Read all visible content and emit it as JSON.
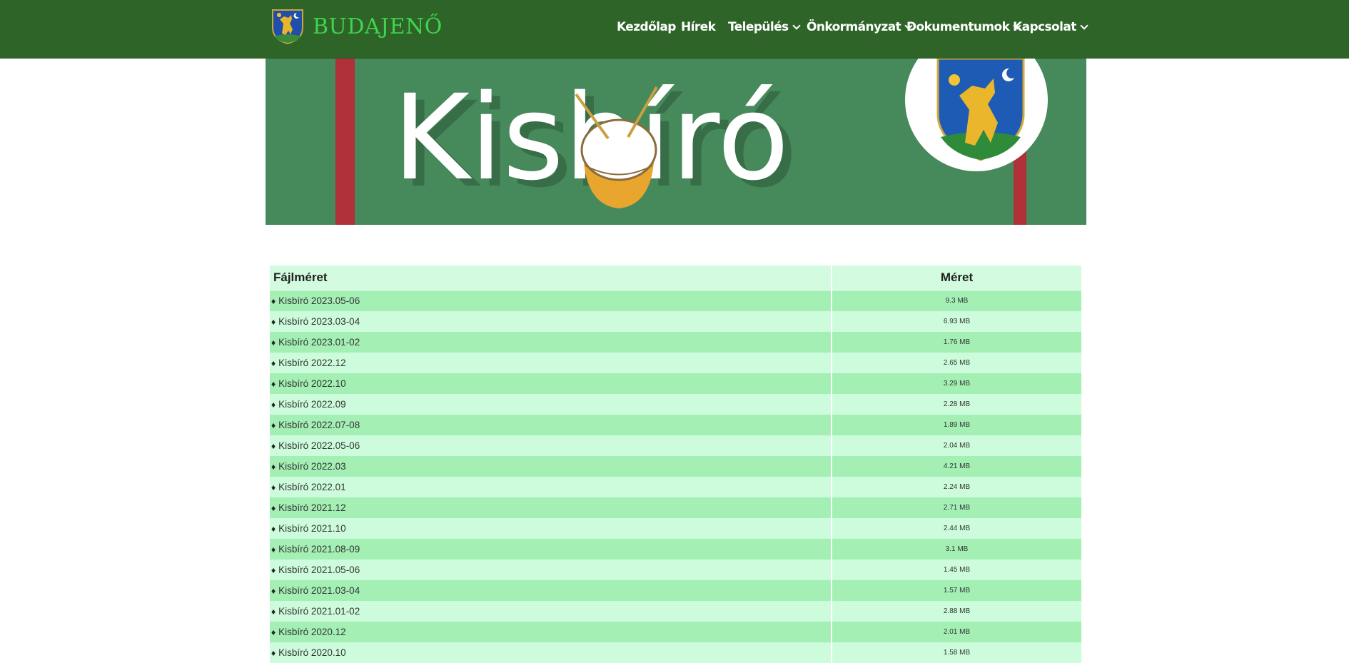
{
  "site": {
    "name": "BUDAJENŐ",
    "logo_icon": "coat-of-arms-icon"
  },
  "nav": {
    "items": [
      {
        "label": "Kezdőlap",
        "dropdown": false
      },
      {
        "label": "Hírek",
        "dropdown": false
      },
      {
        "label": "Település",
        "dropdown": true
      },
      {
        "label": "Önkormányzat",
        "dropdown": true
      },
      {
        "label": "Dokumentumok",
        "dropdown": true
      },
      {
        "label": "Kapcsolat",
        "dropdown": true
      }
    ]
  },
  "banner": {
    "title": "Kisbíró",
    "icons": [
      "drum-icon",
      "coat-of-arms-icon"
    ]
  },
  "table": {
    "headers": {
      "name": "Fájlméret",
      "size": "Méret"
    },
    "bullet": "♦",
    "rows": [
      {
        "name": "Kisbíró 2023.05-06",
        "size": "9.3 MB"
      },
      {
        "name": "Kisbíró 2023.03-04",
        "size": "6.93 MB"
      },
      {
        "name": "Kisbíró 2023.01-02",
        "size": "1.76 MB"
      },
      {
        "name": "Kisbíró 2022.12",
        "size": "2.65 MB"
      },
      {
        "name": "Kisbíró 2022.10",
        "size": "3.29 MB"
      },
      {
        "name": "Kisbíró 2022.09",
        "size": "2.28 MB"
      },
      {
        "name": "Kisbíró 2022.07-08",
        "size": "1.89 MB"
      },
      {
        "name": "Kisbíró 2022.05-06",
        "size": "2.04 MB"
      },
      {
        "name": "Kisbíró 2022.03",
        "size": "4.21 MB"
      },
      {
        "name": "Kisbíró 2022.01",
        "size": "2.24 MB"
      },
      {
        "name": "Kisbíró 2021.12",
        "size": "2.71 MB"
      },
      {
        "name": "Kisbíró 2021.10",
        "size": "2.44 MB"
      },
      {
        "name": "Kisbíró 2021.08-09",
        "size": "3.1 MB"
      },
      {
        "name": "Kisbíró 2021.05-06",
        "size": "1.45 MB"
      },
      {
        "name": "Kisbíró 2021.03-04",
        "size": "1.57 MB"
      },
      {
        "name": "Kisbíró 2021.01-02",
        "size": "2.88 MB"
      },
      {
        "name": "Kisbíró 2020.12",
        "size": "2.01 MB"
      },
      {
        "name": "Kisbíró 2020.10",
        "size": "1.58 MB"
      }
    ]
  },
  "colors": {
    "header_bg": "#2e6428",
    "brand_green": "#3fd44f",
    "banner_bg": "#46895a",
    "row_odd": "#a3efb4",
    "row_even": "#ccfcdb",
    "header_row": "#d2fbdf"
  }
}
